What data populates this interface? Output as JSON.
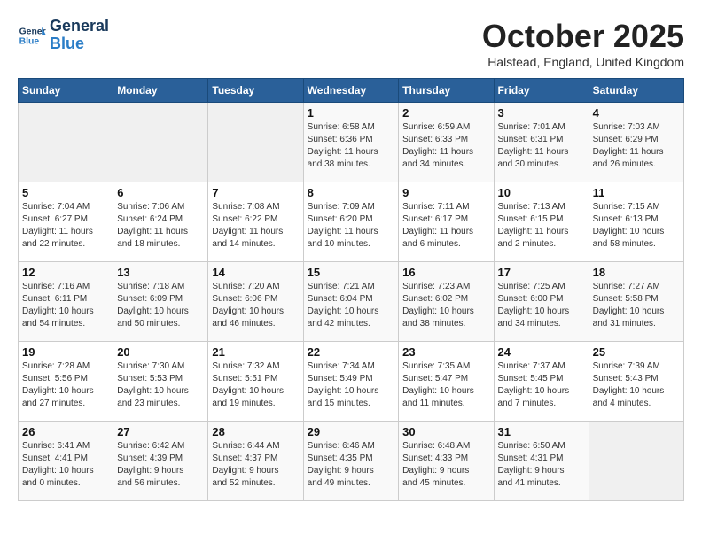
{
  "header": {
    "logo_line1": "General",
    "logo_line2": "Blue",
    "month": "October 2025",
    "location": "Halstead, England, United Kingdom"
  },
  "days_of_week": [
    "Sunday",
    "Monday",
    "Tuesday",
    "Wednesday",
    "Thursday",
    "Friday",
    "Saturday"
  ],
  "weeks": [
    [
      {
        "day": "",
        "info": ""
      },
      {
        "day": "",
        "info": ""
      },
      {
        "day": "",
        "info": ""
      },
      {
        "day": "1",
        "info": "Sunrise: 6:58 AM\nSunset: 6:36 PM\nDaylight: 11 hours\nand 38 minutes."
      },
      {
        "day": "2",
        "info": "Sunrise: 6:59 AM\nSunset: 6:33 PM\nDaylight: 11 hours\nand 34 minutes."
      },
      {
        "day": "3",
        "info": "Sunrise: 7:01 AM\nSunset: 6:31 PM\nDaylight: 11 hours\nand 30 minutes."
      },
      {
        "day": "4",
        "info": "Sunrise: 7:03 AM\nSunset: 6:29 PM\nDaylight: 11 hours\nand 26 minutes."
      }
    ],
    [
      {
        "day": "5",
        "info": "Sunrise: 7:04 AM\nSunset: 6:27 PM\nDaylight: 11 hours\nand 22 minutes."
      },
      {
        "day": "6",
        "info": "Sunrise: 7:06 AM\nSunset: 6:24 PM\nDaylight: 11 hours\nand 18 minutes."
      },
      {
        "day": "7",
        "info": "Sunrise: 7:08 AM\nSunset: 6:22 PM\nDaylight: 11 hours\nand 14 minutes."
      },
      {
        "day": "8",
        "info": "Sunrise: 7:09 AM\nSunset: 6:20 PM\nDaylight: 11 hours\nand 10 minutes."
      },
      {
        "day": "9",
        "info": "Sunrise: 7:11 AM\nSunset: 6:17 PM\nDaylight: 11 hours\nand 6 minutes."
      },
      {
        "day": "10",
        "info": "Sunrise: 7:13 AM\nSunset: 6:15 PM\nDaylight: 11 hours\nand 2 minutes."
      },
      {
        "day": "11",
        "info": "Sunrise: 7:15 AM\nSunset: 6:13 PM\nDaylight: 10 hours\nand 58 minutes."
      }
    ],
    [
      {
        "day": "12",
        "info": "Sunrise: 7:16 AM\nSunset: 6:11 PM\nDaylight: 10 hours\nand 54 minutes."
      },
      {
        "day": "13",
        "info": "Sunrise: 7:18 AM\nSunset: 6:09 PM\nDaylight: 10 hours\nand 50 minutes."
      },
      {
        "day": "14",
        "info": "Sunrise: 7:20 AM\nSunset: 6:06 PM\nDaylight: 10 hours\nand 46 minutes."
      },
      {
        "day": "15",
        "info": "Sunrise: 7:21 AM\nSunset: 6:04 PM\nDaylight: 10 hours\nand 42 minutes."
      },
      {
        "day": "16",
        "info": "Sunrise: 7:23 AM\nSunset: 6:02 PM\nDaylight: 10 hours\nand 38 minutes."
      },
      {
        "day": "17",
        "info": "Sunrise: 7:25 AM\nSunset: 6:00 PM\nDaylight: 10 hours\nand 34 minutes."
      },
      {
        "day": "18",
        "info": "Sunrise: 7:27 AM\nSunset: 5:58 PM\nDaylight: 10 hours\nand 31 minutes."
      }
    ],
    [
      {
        "day": "19",
        "info": "Sunrise: 7:28 AM\nSunset: 5:56 PM\nDaylight: 10 hours\nand 27 minutes."
      },
      {
        "day": "20",
        "info": "Sunrise: 7:30 AM\nSunset: 5:53 PM\nDaylight: 10 hours\nand 23 minutes."
      },
      {
        "day": "21",
        "info": "Sunrise: 7:32 AM\nSunset: 5:51 PM\nDaylight: 10 hours\nand 19 minutes."
      },
      {
        "day": "22",
        "info": "Sunrise: 7:34 AM\nSunset: 5:49 PM\nDaylight: 10 hours\nand 15 minutes."
      },
      {
        "day": "23",
        "info": "Sunrise: 7:35 AM\nSunset: 5:47 PM\nDaylight: 10 hours\nand 11 minutes."
      },
      {
        "day": "24",
        "info": "Sunrise: 7:37 AM\nSunset: 5:45 PM\nDaylight: 10 hours\nand 7 minutes."
      },
      {
        "day": "25",
        "info": "Sunrise: 7:39 AM\nSunset: 5:43 PM\nDaylight: 10 hours\nand 4 minutes."
      }
    ],
    [
      {
        "day": "26",
        "info": "Sunrise: 6:41 AM\nSunset: 4:41 PM\nDaylight: 10 hours\nand 0 minutes."
      },
      {
        "day": "27",
        "info": "Sunrise: 6:42 AM\nSunset: 4:39 PM\nDaylight: 9 hours\nand 56 minutes."
      },
      {
        "day": "28",
        "info": "Sunrise: 6:44 AM\nSunset: 4:37 PM\nDaylight: 9 hours\nand 52 minutes."
      },
      {
        "day": "29",
        "info": "Sunrise: 6:46 AM\nSunset: 4:35 PM\nDaylight: 9 hours\nand 49 minutes."
      },
      {
        "day": "30",
        "info": "Sunrise: 6:48 AM\nSunset: 4:33 PM\nDaylight: 9 hours\nand 45 minutes."
      },
      {
        "day": "31",
        "info": "Sunrise: 6:50 AM\nSunset: 4:31 PM\nDaylight: 9 hours\nand 41 minutes."
      },
      {
        "day": "",
        "info": ""
      }
    ]
  ]
}
